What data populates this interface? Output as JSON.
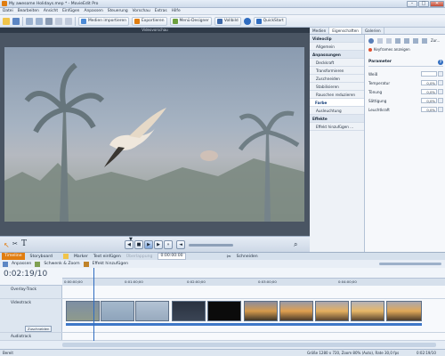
{
  "window": {
    "title": "My awesome Holidays.mep * - MovieEdit Pro",
    "btn_min": "–",
    "btn_max": "□",
    "btn_close": "✕"
  },
  "menu": [
    "Datei",
    "Bearbeiten",
    "Ansicht",
    "Einfügen",
    "Anpassen",
    "Steuerung",
    "Vorschau",
    "Extras",
    "Hilfe"
  ],
  "toolbar": {
    "import_label": "Medien importieren",
    "export_label": "Exportieren",
    "menu_designer_label": "Menü-Designer",
    "fullscreen_label": "Vollbild",
    "quickstart_label": "QuickStart"
  },
  "preview": {
    "header": "Videovorschau"
  },
  "controls": {
    "timecode": "0:02:19/10"
  },
  "right_tabs": [
    "Medien",
    "Eigenschaften",
    "Galerien"
  ],
  "categories": [
    {
      "label": "Videoclip",
      "kind": "group"
    },
    {
      "label": "Allgemein",
      "kind": "sub"
    },
    {
      "label": "Anpassungen",
      "kind": "group"
    },
    {
      "label": "Deckkraft",
      "kind": "sub"
    },
    {
      "label": "Transformieren",
      "kind": "sub"
    },
    {
      "label": "Zuschneiden",
      "kind": "sub"
    },
    {
      "label": "Stabilisieren",
      "kind": "sub"
    },
    {
      "label": "Rauschen reduzieren",
      "kind": "sub"
    },
    {
      "label": "Farbe",
      "kind": "sel"
    },
    {
      "label": "Ausleuchtung",
      "kind": "sub"
    },
    {
      "label": "Effekte",
      "kind": "group"
    },
    {
      "label": "Effekt hinzufügen ...",
      "kind": "sub"
    }
  ],
  "properties": {
    "keyframes_label": "Keyframes anzeigen",
    "section_label": "Parameter",
    "reset_label": "Zur..."
  },
  "params": [
    {
      "label": "Weiß",
      "value": ""
    },
    {
      "label": "Temperatur",
      "value": "0,0%"
    },
    {
      "label": "Tönung",
      "value": "0,0%"
    },
    {
      "label": "Sättigung",
      "value": "0,0%"
    },
    {
      "label": "Leuchtkraft",
      "value": "0,0%"
    }
  ],
  "timeline": {
    "tab_timeline": "Timeline",
    "tab_storyboard": "Storyboard",
    "insert_label": "Text einfügen",
    "marker_label": "Marker",
    "overlap_label": "Überlappung",
    "overlap_value": "0:00:00:00",
    "cut_label": "Schneiden",
    "fit_label": "Anpassen",
    "swipe_label": "Schwenk & Zoom",
    "effect_label": "Effekt hinzufügen",
    "timecode": "0:02:19/10",
    "ruler": [
      "0:00:00;00",
      "0:01:00;00",
      "0:02:00;00",
      "0:03:00;00",
      "0:04:00;00"
    ],
    "tracks": [
      {
        "name": "Overlay-Track"
      },
      {
        "name": "Videotrack"
      },
      {
        "name": "Audiotrack"
      }
    ],
    "button_crop": "Zuschneiden"
  },
  "status": {
    "left": "Bereit",
    "info": "Größe 1280 x 720, Zoom 80% (Auto), Rate 30,0 fps",
    "time": "0:02:19/10"
  },
  "colors": {
    "accent": "#e07d10",
    "timeline_blue": "#3f78c8"
  }
}
